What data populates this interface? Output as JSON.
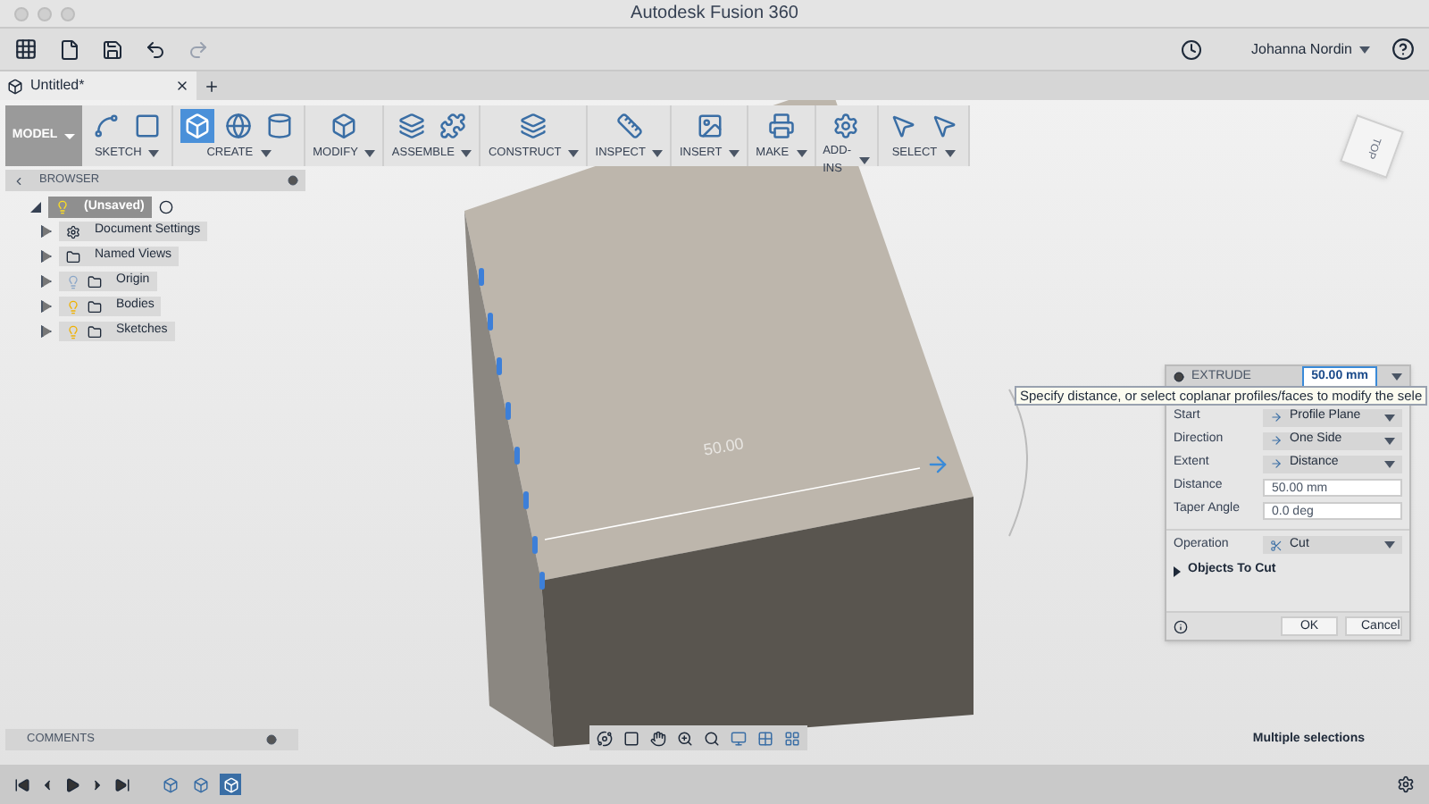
{
  "window": {
    "title": "Autodesk Fusion 360"
  },
  "toolbar": {
    "user": "Johanna Nordin"
  },
  "document_tab": {
    "title": "Untitled*"
  },
  "workspace": {
    "label": "MODEL"
  },
  "ribbon": [
    {
      "label": "SKETCH",
      "active": false
    },
    {
      "label": "CREATE",
      "active": true
    },
    {
      "label": "MODIFY",
      "active": false
    },
    {
      "label": "ASSEMBLE",
      "active": false
    },
    {
      "label": "CONSTRUCT",
      "active": false
    },
    {
      "label": "INSPECT",
      "active": false
    },
    {
      "label": "INSERT",
      "active": false
    },
    {
      "label": "MAKE",
      "active": false
    },
    {
      "label": "ADD-INS",
      "active": false
    },
    {
      "label": "SELECT",
      "active": false
    }
  ],
  "browser": {
    "title": "BROWSER",
    "root": {
      "label": "(Unsaved)",
      "expanded": true,
      "selected": true,
      "children": [
        {
          "label": "Document Settings",
          "kind": "settings",
          "expanded": false,
          "selected": false
        },
        {
          "label": "Named Views",
          "kind": "folder",
          "expanded": false,
          "selected": false
        },
        {
          "label": "Origin",
          "kind": "folder",
          "expanded": false,
          "visible": false,
          "selected": false
        },
        {
          "label": "Bodies",
          "kind": "folder",
          "expanded": false,
          "visible": true,
          "selected": false
        },
        {
          "label": "Sketches",
          "kind": "folder",
          "expanded": false,
          "visible": true,
          "selected": false
        }
      ]
    }
  },
  "viewcube": {
    "face": "TOP"
  },
  "model": {
    "dimension": "50.00"
  },
  "tooltip": {
    "text": "Specify distance, or select coplanar profiles/faces to modify the sele"
  },
  "extrude": {
    "title": "EXTRUDE",
    "value": "50.00 mm",
    "rows": [
      {
        "label": "Start",
        "kind": "select",
        "value": "Profile Plane"
      },
      {
        "label": "Direction",
        "kind": "select",
        "value": "One Side"
      },
      {
        "label": "Extent",
        "kind": "select",
        "value": "Distance"
      },
      {
        "label": "Distance",
        "kind": "input",
        "value": "50.00 mm"
      },
      {
        "label": "Taper Angle",
        "kind": "input",
        "value": "0.0 deg"
      },
      {
        "label": "Operation",
        "kind": "select",
        "value": "Cut"
      }
    ],
    "section": {
      "label": "Objects To Cut",
      "expanded": false
    },
    "buttons": [
      "OK",
      "Cancel"
    ]
  },
  "comments": {
    "title": "COMMENTS"
  },
  "status": "Multiple selections",
  "timeline": [
    {
      "selected": false
    },
    {
      "selected": false
    },
    {
      "selected": true
    }
  ]
}
